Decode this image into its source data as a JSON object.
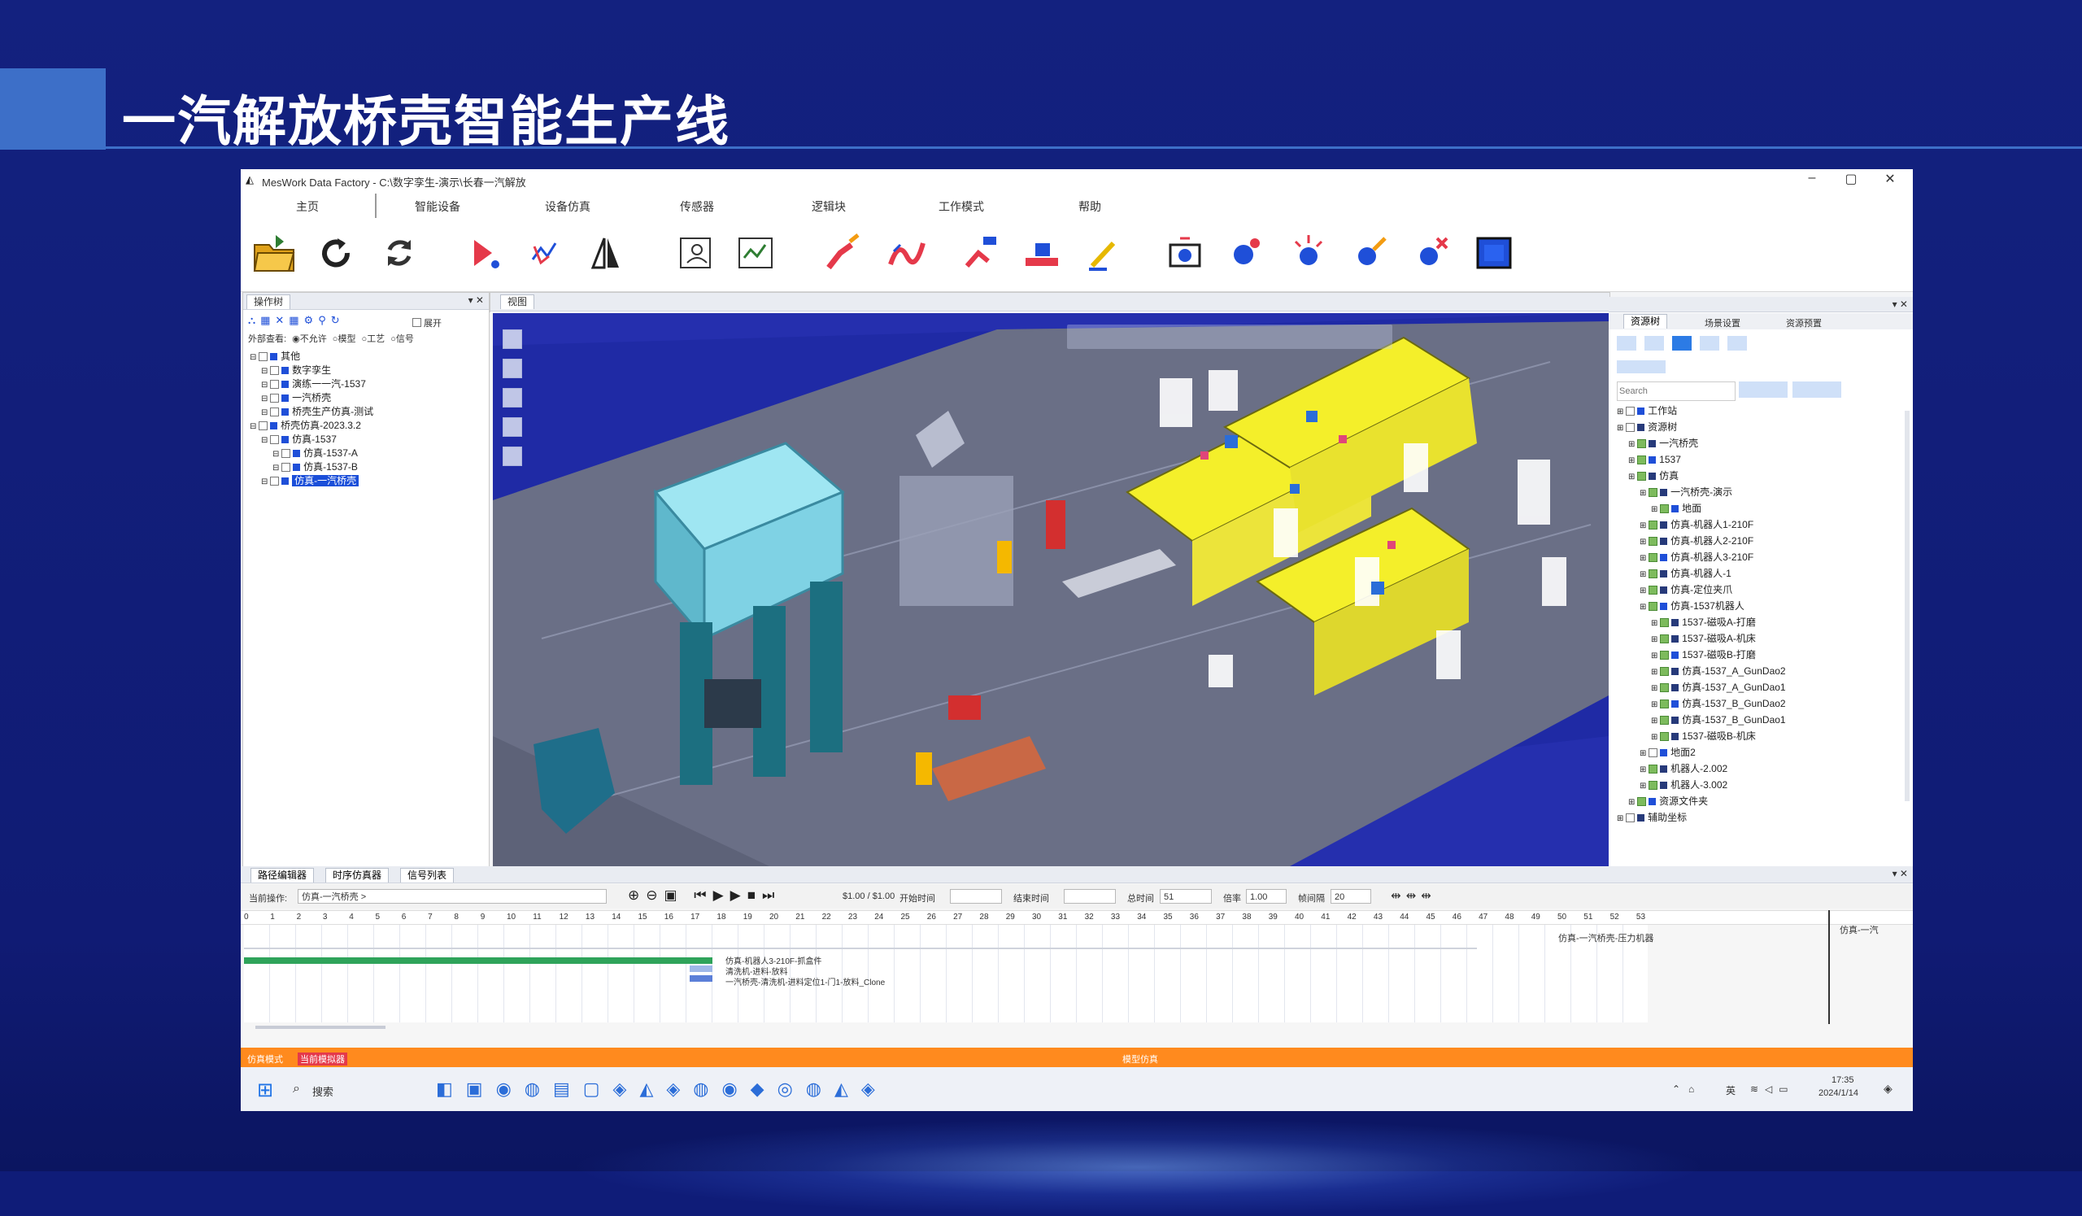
{
  "slide": {
    "title": "一汽解放桥壳智能生产线"
  },
  "window": {
    "title": "MesWork Data Factory - C:\\数字孪生-演示\\长春一汽解放",
    "minimize": "–",
    "maximize": "▢",
    "close": "✕"
  },
  "menu": [
    "主页",
    "智能设备",
    "设备仿真",
    "传感器",
    "逻辑块",
    "工作模式",
    "帮助"
  ],
  "left_panel": {
    "tab": "操作树",
    "toolbar_checkbox": "展开",
    "filter_label": "外部查看:",
    "filter_options": [
      "不允许",
      "模型",
      "工艺",
      "信号"
    ],
    "tree": [
      {
        "label": "其他",
        "indent": 0,
        "sel": false
      },
      {
        "label": "数字孪生",
        "indent": 1,
        "sel": false
      },
      {
        "label": "演练一一汽-1537",
        "indent": 1,
        "sel": false
      },
      {
        "label": "一汽桥壳",
        "indent": 1,
        "sel": false
      },
      {
        "label": "桥壳生产仿真-测试",
        "indent": 1,
        "sel": false
      },
      {
        "label": "桥壳仿真-2023.3.2",
        "indent": 0,
        "sel": false
      },
      {
        "label": "仿真-1537",
        "indent": 1,
        "sel": false
      },
      {
        "label": "仿真-1537-A",
        "indent": 2,
        "sel": false
      },
      {
        "label": "仿真-1537-B",
        "indent": 2,
        "sel": false
      },
      {
        "label": "仿真-一汽桥壳",
        "indent": 1,
        "sel": true
      }
    ]
  },
  "viewport": {
    "tab": "视图"
  },
  "right_panel": {
    "tabs": [
      "资源树",
      "场景设置",
      "资源预置"
    ],
    "search_placeholder": "Search",
    "tree": [
      {
        "label": "工作站",
        "indent": 0,
        "checked": false
      },
      {
        "label": "资源树",
        "indent": 0,
        "checked": false
      },
      {
        "label": "一汽桥壳",
        "indent": 1,
        "checked": true
      },
      {
        "label": "1537",
        "indent": 1,
        "checked": true
      },
      {
        "label": "仿真",
        "indent": 1,
        "checked": true
      },
      {
        "label": "一汽桥壳-演示",
        "indent": 2,
        "checked": true
      },
      {
        "label": "地面",
        "indent": 3,
        "checked": true
      },
      {
        "label": "仿真-机器人1-210F",
        "indent": 2,
        "checked": true
      },
      {
        "label": "仿真-机器人2-210F",
        "indent": 2,
        "checked": true
      },
      {
        "label": "仿真-机器人3-210F",
        "indent": 2,
        "checked": true
      },
      {
        "label": "仿真-机器人-1",
        "indent": 2,
        "checked": true
      },
      {
        "label": "仿真-定位夹爪",
        "indent": 2,
        "checked": true
      },
      {
        "label": "仿真-1537机器人",
        "indent": 2,
        "checked": true
      },
      {
        "label": "1537-磁吸A-打磨",
        "indent": 3,
        "checked": true
      },
      {
        "label": "1537-磁吸A-机床",
        "indent": 3,
        "checked": true
      },
      {
        "label": "1537-磁吸B-打磨",
        "indent": 3,
        "checked": true
      },
      {
        "label": "仿真-1537_A_GunDao2",
        "indent": 3,
        "checked": true
      },
      {
        "label": "仿真-1537_A_GunDao1",
        "indent": 3,
        "checked": true
      },
      {
        "label": "仿真-1537_B_GunDao2",
        "indent": 3,
        "checked": true
      },
      {
        "label": "仿真-1537_B_GunDao1",
        "indent": 3,
        "checked": true
      },
      {
        "label": "1537-磁吸B-机床",
        "indent": 3,
        "checked": true
      },
      {
        "label": "地面2",
        "indent": 2,
        "checked": false
      },
      {
        "label": "机器人-2.002",
        "indent": 2,
        "checked": true
      },
      {
        "label": "机器人-3.002",
        "indent": 2,
        "checked": true
      },
      {
        "label": "资源文件夹",
        "indent": 1,
        "checked": true
      },
      {
        "label": "辅助坐标",
        "indent": 0,
        "checked": false
      }
    ]
  },
  "timeline": {
    "tabs": [
      "路径编辑器",
      "时序仿真器",
      "信号列表"
    ],
    "current_op_label": "当前操作:",
    "current_op_value": "仿真-一汽桥壳 >",
    "speed": "$1.00 / $1.00",
    "start_label": "开始时间",
    "end_label": "结束时间",
    "total_label": "总时间",
    "total_value": "51",
    "ratio_label": "倍率",
    "ratio_value": "1.00",
    "step_label": "帧间隔",
    "step_value": "20",
    "ticks": [
      "0",
      "1",
      "2",
      "3",
      "4",
      "5",
      "6",
      "7",
      "8",
      "9",
      "10",
      "11",
      "12",
      "13",
      "14",
      "15",
      "16",
      "17",
      "18",
      "19",
      "20",
      "21",
      "22",
      "23",
      "24",
      "25",
      "26",
      "27",
      "28",
      "29",
      "30",
      "31",
      "32",
      "33",
      "34",
      "35",
      "36",
      "37",
      "38",
      "39",
      "40",
      "41",
      "42",
      "43",
      "44",
      "45",
      "46",
      "47",
      "48",
      "49",
      "50",
      "51",
      "52",
      "53"
    ],
    "tracks": [
      {
        "label": "仿真-机器人3-210F-抓盒件",
        "color": "#2fa35a"
      },
      {
        "label": "清洗机-进料-放料",
        "color": "#9fb8e8"
      },
      {
        "label": "一汽桥壳-清洗机-进料定位1-门1-放料_Clone",
        "color": "#5b7fd8"
      }
    ],
    "right_label": "仿真-一汽桥壳-压力机器",
    "far_right_label": "仿真-一汽"
  },
  "status": {
    "left1": "仿真模式",
    "left2": "当前模拟器",
    "center": "模型仿真"
  },
  "taskbar": {
    "search": "搜索",
    "lang": "英",
    "time": "17:35",
    "date": "2024/1/14"
  },
  "colors": {
    "slide_bg": "#13217f",
    "accent": "#3d6fc8",
    "viewport_bg": "#252fae",
    "status_bar": "#ff8a1e"
  }
}
